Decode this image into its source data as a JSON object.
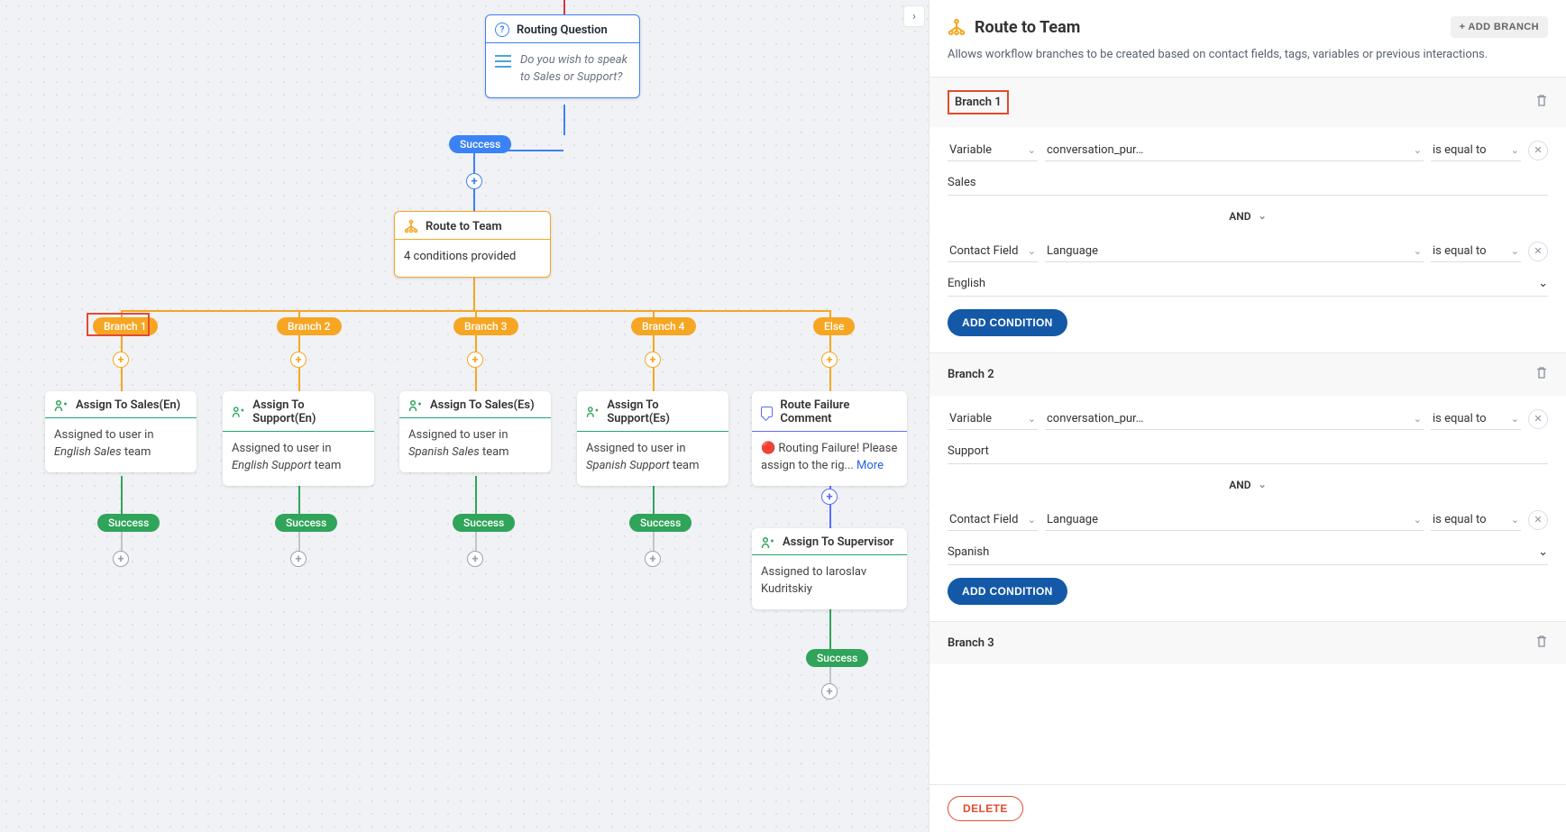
{
  "canvas": {
    "nodes": {
      "routing_question": {
        "title": "Routing Question",
        "body": "Do you wish to speak to Sales or Support?"
      },
      "route_team": {
        "title": "Route to Team",
        "body": "4 conditions provided"
      },
      "assign1": {
        "title": "Assign To Sales(En)",
        "body_prefix": "Assigned to user in ",
        "body_team": "English Sales",
        "body_suffix": " team"
      },
      "assign2": {
        "title": "Assign To Support(En)",
        "body_prefix": "Assigned to user in ",
        "body_team": "English Support",
        "body_suffix": " team"
      },
      "assign3": {
        "title": "Assign To Sales(Es)",
        "body_prefix": "Assigned to user in ",
        "body_team": "Spanish Sales",
        "body_suffix": " team"
      },
      "assign4": {
        "title": "Assign To Support(Es)",
        "body_prefix": "Assigned to user in ",
        "body_team": "Spanish Support",
        "body_suffix": " team"
      },
      "failure": {
        "title": "Route Failure Comment",
        "body": "🔴 Routing Failure! Please assign to the rig...",
        "more": " More"
      },
      "assign_sup": {
        "title": "Assign To Supervisor",
        "body": "Assigned to Iaroslav Kudritskiy"
      }
    },
    "pills": {
      "success_top": "Success",
      "branch1": "Branch 1",
      "branch2": "Branch 2",
      "branch3": "Branch 3",
      "branch4": "Branch 4",
      "else": "Else",
      "success": "Success"
    }
  },
  "sidebar": {
    "title": "Route to Team",
    "add_branch": "+ ADD BRANCH",
    "description": "Allows workflow branches to be created based on contact fields, tags, variables or previous interactions.",
    "and_label": "AND",
    "add_condition": "ADD CONDITION",
    "delete": "DELETE",
    "branches": [
      {
        "name": "Branch 1",
        "highlight": true,
        "conditions": [
          {
            "field_type": "Variable",
            "field_value": "conversation_pur…",
            "operator": "is equal to",
            "value": "Sales",
            "value_is_dd": false
          },
          {
            "field_type": "Contact Field",
            "field_value": "Language",
            "operator": "is equal to",
            "value": "English",
            "value_is_dd": true
          }
        ]
      },
      {
        "name": "Branch 2",
        "highlight": false,
        "conditions": [
          {
            "field_type": "Variable",
            "field_value": "conversation_pur…",
            "operator": "is equal to",
            "value": "Support",
            "value_is_dd": false
          },
          {
            "field_type": "Contact Field",
            "field_value": "Language",
            "operator": "is equal to",
            "value": "Spanish",
            "value_is_dd": true
          }
        ]
      },
      {
        "name": "Branch 3",
        "highlight": false,
        "collapsed": true
      }
    ]
  }
}
